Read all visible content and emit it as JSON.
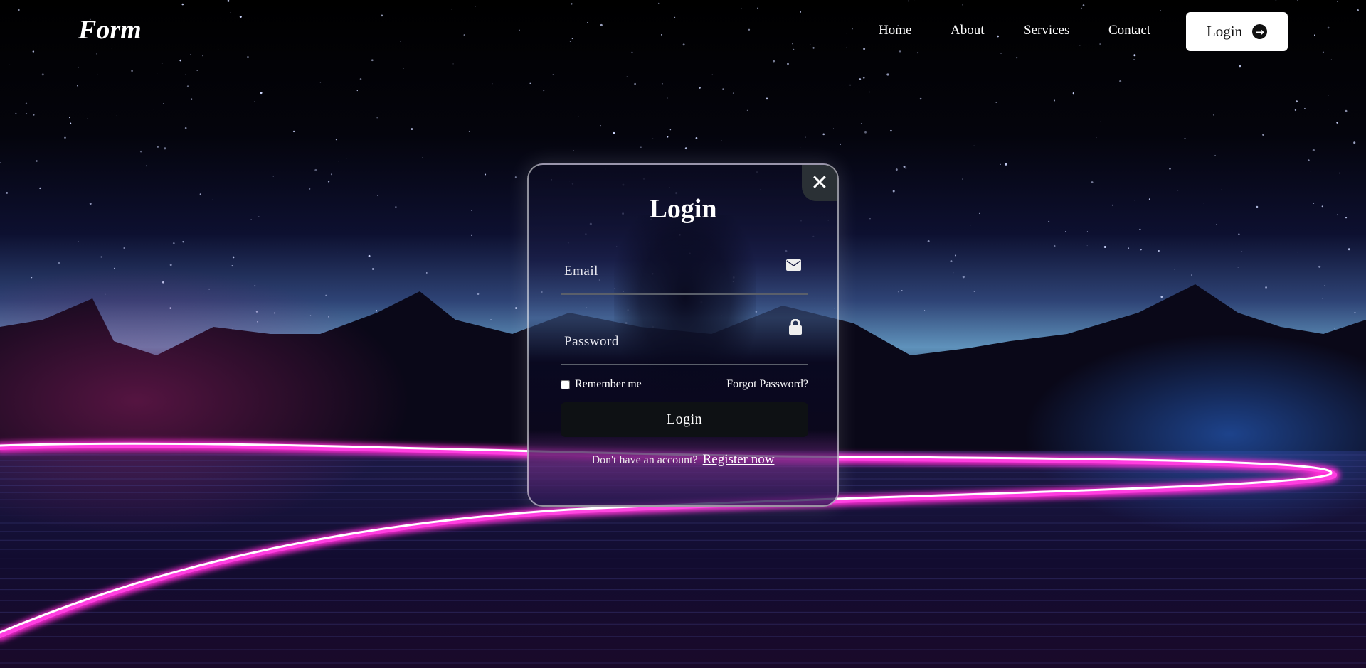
{
  "header": {
    "logo": "Form",
    "nav": [
      {
        "label": "Home"
      },
      {
        "label": "About"
      },
      {
        "label": "Services"
      },
      {
        "label": "Contact"
      }
    ],
    "login_button": "Login",
    "login_icon": "arrow-right-circle-icon"
  },
  "modal": {
    "title": "Login",
    "close_icon": "close-icon",
    "email": {
      "label": "Email",
      "value": "",
      "icon": "envelope-icon"
    },
    "password": {
      "label": "Password",
      "value": "",
      "icon": "lock-icon"
    },
    "remember_label": "Remember me",
    "remember_checked": false,
    "forgot_link": "Forgot Password?",
    "submit_label": "Login",
    "register_prompt": "Don't have an account?",
    "register_link": "Register now"
  },
  "colors": {
    "neon_pink": "#ff2bd6",
    "horizon_blue": "#5a8ab8",
    "button_dark": "#0e1114"
  }
}
